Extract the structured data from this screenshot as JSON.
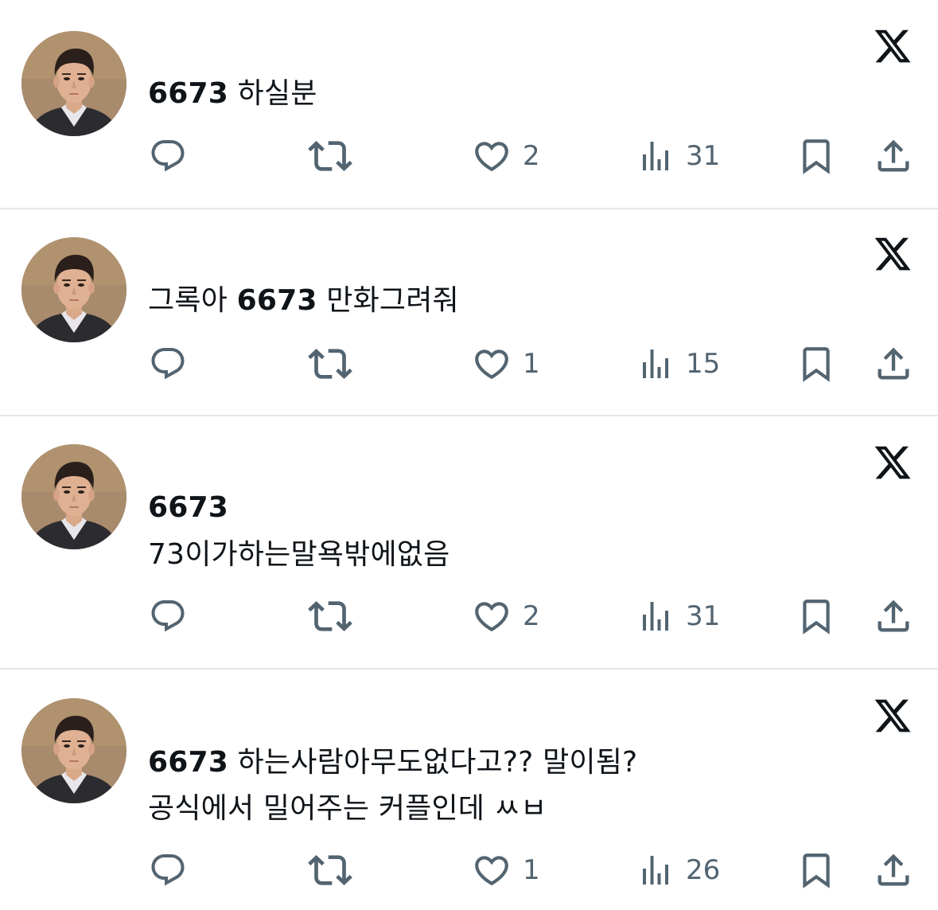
{
  "posts": [
    {
      "line1_bold": "6673",
      "line1_rest": " 하실분",
      "line1_pre": "",
      "line2": "",
      "likes": "2",
      "views": "31"
    },
    {
      "line1_pre": "그록아 ",
      "line1_bold": "6673",
      "line1_rest": " 만화그려줘",
      "line2": "",
      "likes": "1",
      "views": "15"
    },
    {
      "line1_pre": "",
      "line1_bold": "6673",
      "line1_rest": "",
      "line2": "73이가하는말욕밖에없음",
      "likes": "2",
      "views": "31"
    },
    {
      "line1_pre": "",
      "line1_bold": "6673",
      "line1_rest": " 하는사람아무도없다고?? 말이됨?",
      "line2": "공식에서 밀어주는 커플인데 ㅆㅂ",
      "likes": "1",
      "views": "26"
    }
  ],
  "icons": {
    "reply": "reply-icon",
    "repost": "repost-icon",
    "like": "heart-icon",
    "views": "views-icon",
    "bookmark": "bookmark-icon",
    "share": "share-icon",
    "brand": "x-logo-icon"
  },
  "colors": {
    "text": "#0f1419",
    "muted": "#536471",
    "divider": "#e6e6e6"
  }
}
